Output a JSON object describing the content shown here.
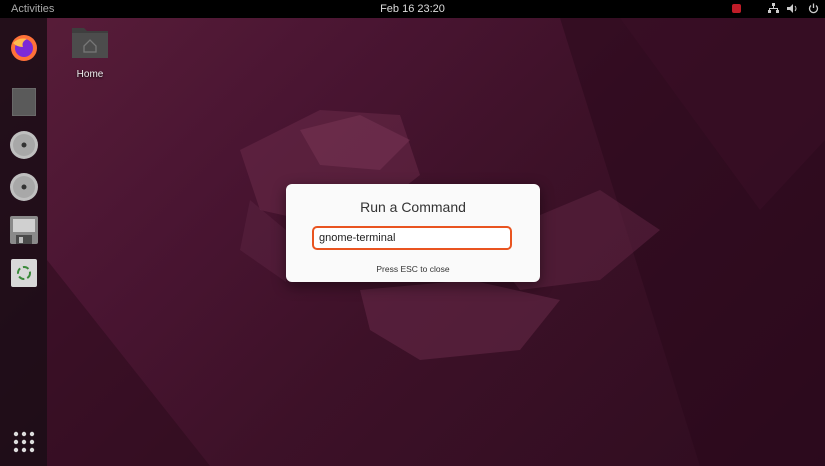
{
  "topbar": {
    "activities": "Activities",
    "clock": "Feb 16  23:20"
  },
  "desktop": {
    "home_label": "Home"
  },
  "dialog": {
    "title": "Run a Command",
    "input_value": "gnome-terminal",
    "hint": "Press ESC to close"
  },
  "colors": {
    "accent": "#e95420",
    "record_indicator": "#c01c28"
  },
  "dock": {
    "items": [
      "firefox-icon",
      "files-icon",
      "disc-icon",
      "disc-icon",
      "floppy-icon",
      "trash-icon"
    ],
    "show_apps": "app-grid-icon"
  }
}
